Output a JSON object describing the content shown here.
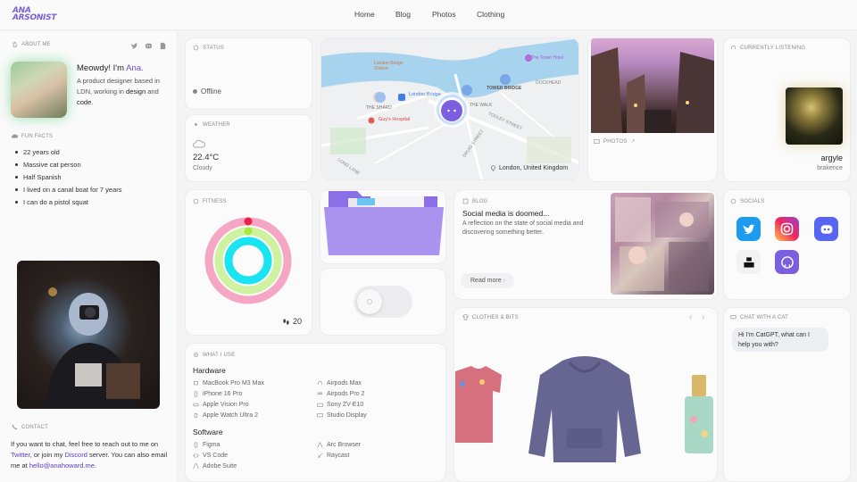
{
  "header": {
    "logo_line1": "ANA",
    "logo_line2": "ARSONIST",
    "nav": [
      "Home",
      "Blog",
      "Photos",
      "Clothing"
    ]
  },
  "sidebar": {
    "about_label": "ABOUT ME",
    "greeting": "Meowdy! I'm ",
    "name": "Ana.",
    "bio_pre": "A product designer based in LDN, working in ",
    "bio_design": "design",
    "bio_mid": " and ",
    "bio_code": "code",
    "bio_post": ".",
    "fun_facts_label": "FUN FACTS",
    "fun_facts": [
      "22 years old",
      "Massive cat person",
      "Half Spanish",
      "I lived on a canal boat for 7 years",
      "I can do a pistol squat"
    ],
    "contact_label": "CONTACT",
    "contact_pre": "If you want to chat, feel free to reach out to me on ",
    "contact_twitter": "Twitter",
    "contact_mid1": ", or join my ",
    "contact_discord": "Discord",
    "contact_mid2": " server. You can also email me at ",
    "contact_email": "hello@anahoward.me",
    "contact_post": "."
  },
  "status": {
    "label": "STATUS",
    "value": "Offline"
  },
  "weather": {
    "label": "WEATHER",
    "temp": "22.4°C",
    "condition": "Cloudy"
  },
  "map": {
    "location": "London, United Kingdom",
    "places": [
      "London Bridge Station",
      "The Tower Hotel",
      "London Bridge",
      "THE SHARD",
      "Guy's Hospital",
      "TOWER BRIDGE",
      "THE WALK",
      "DOCKHEAD",
      "TOOLEY STREET",
      "DRUID STREET",
      "LONG LANE"
    ]
  },
  "photos": {
    "label": "PHOTOS"
  },
  "listening": {
    "label": "CURRENTLY LISTENING",
    "track": "argyle",
    "artist": "brakence"
  },
  "fitness": {
    "label": "FITNESS",
    "steps": "20"
  },
  "blog": {
    "label": "BLOG",
    "title": "Social media is doomed...",
    "excerpt": "A reflection on the state of social media and discovering something better.",
    "read_more": "Read more"
  },
  "socials": {
    "label": "SOCIALS",
    "items": [
      "twitter-icon",
      "instagram-icon",
      "discord-icon",
      "unsplash-icon",
      "github-icon"
    ]
  },
  "gear": {
    "label": "WHAT I USE",
    "hardware_title": "Hardware",
    "hardware_left": [
      "MacBook Pro M3 Max",
      "iPhone 16 Pro",
      "Apple Vision Pro",
      "Apple Watch Ultra 2"
    ],
    "hardware_right": [
      "Airpods Max",
      "Airpods Pro 2",
      "Sony ZV-E10",
      "Studio Display"
    ],
    "software_title": "Software",
    "software_left": [
      "Figma",
      "VS Code",
      "Adobe Suite"
    ],
    "software_right": [
      "Arc Browser",
      "Raycast"
    ]
  },
  "clothes": {
    "label": "CLOTHES & BITS"
  },
  "chat": {
    "label": "CHAT WITH A CAT",
    "message": "Hi I'm CatGPT, what can I help you with?"
  },
  "colors": {
    "accent": "#6b4fd0",
    "background": "#f4f4f5",
    "card": "#fbfbfb"
  }
}
